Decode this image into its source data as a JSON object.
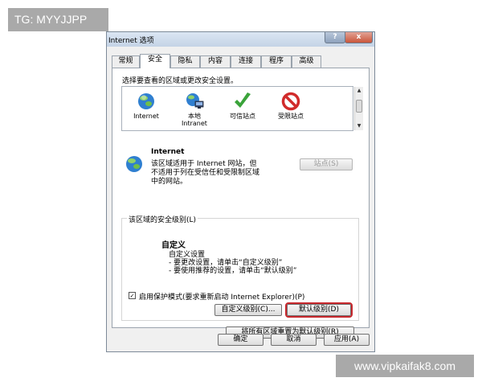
{
  "watermarks": {
    "top": "TG: MYYJJPP",
    "bottom": "www.vipkaifak8.com"
  },
  "window": {
    "title": "Internet 选项",
    "help_label": "?",
    "close_label": "x"
  },
  "tabs": [
    {
      "label": "常规",
      "active": false
    },
    {
      "label": "安全",
      "active": true
    },
    {
      "label": "隐私",
      "active": false
    },
    {
      "label": "内容",
      "active": false
    },
    {
      "label": "连接",
      "active": false
    },
    {
      "label": "程序",
      "active": false
    },
    {
      "label": "高级",
      "active": false
    }
  ],
  "security": {
    "zone_prompt": "选择要查看的区域或更改安全设置。",
    "zones": [
      {
        "label": "Internet",
        "icon": "globe-icon"
      },
      {
        "label": "本地\nIntranet",
        "icon": "intranet-icon"
      },
      {
        "label": "可信站点",
        "icon": "checkmark-icon"
      },
      {
        "label": "受限站点",
        "icon": "restricted-icon"
      }
    ],
    "selected_zone_title": "Internet",
    "selected_zone_desc": "该区域适用于 Internet 网站，但\n不适用于列在受信任和受限制区域\n中的网站。",
    "sites_button": "站点(S)",
    "level_group_title": "该区域的安全级别(L)",
    "level_name": "自定义",
    "level_desc_1": "自定义设置",
    "level_desc_2": "- 要更改设置，请单击“自定义级别”",
    "level_desc_3": "- 要使用推荐的设置，请单击“默认级别”",
    "protected_mode_label": "启用保护模式(要求重新启动 Internet Explorer)(P)",
    "protected_mode_checked": true,
    "custom_level_button": "自定义级别(C)...",
    "default_level_button": "默认级别(D)",
    "reset_all_button": "将所有区域重置为默认级别(R)"
  },
  "footer": {
    "ok": "确定",
    "cancel": "取消",
    "apply": "应用(A)"
  },
  "colors": {
    "highlight_border": "#c8282d",
    "check_green": "#3aa33a",
    "restricted_red": "#d12b2b",
    "globe_blue": "#2f7fd0"
  }
}
